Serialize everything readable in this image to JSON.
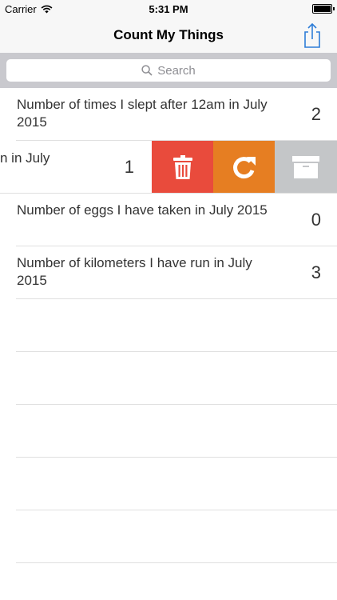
{
  "status_bar": {
    "carrier": "Carrier",
    "time": "5:31 PM"
  },
  "nav": {
    "title": "Count My Things"
  },
  "search": {
    "placeholder": "Search"
  },
  "rows": [
    {
      "label": "Number of times I slept after 12am in July 2015",
      "count": "2"
    },
    {
      "label": "Number of cups of coffee I have drunk in July",
      "visible_label_fragment": "n in July",
      "count": "1"
    },
    {
      "label": "Number of eggs I have taken in July 2015",
      "count": "0"
    },
    {
      "label": "Number of kilometers I have run in July 2015",
      "count": "3"
    }
  ],
  "actions": {
    "delete": "trash-icon",
    "reset": "refresh-icon",
    "archive": "archive-icon"
  },
  "colors": {
    "delete": "#e94b3c",
    "reset": "#e67e22",
    "archive": "#c4c6c8",
    "accent": "#2e7dd7"
  }
}
